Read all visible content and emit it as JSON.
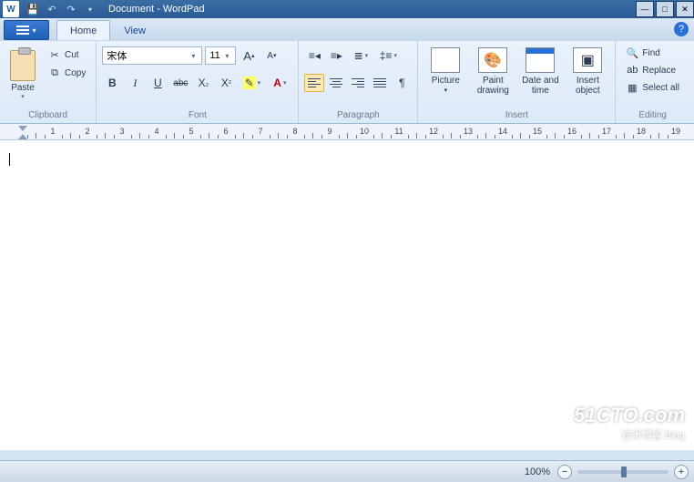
{
  "title": "Document - WordPad",
  "tabs": {
    "home": "Home",
    "view": "View"
  },
  "clipboard": {
    "paste": "Paste",
    "cut": "Cut",
    "copy": "Copy",
    "label": "Clipboard"
  },
  "font": {
    "name": "宋体",
    "size": "11",
    "label": "Font"
  },
  "paragraph": {
    "label": "Paragraph"
  },
  "insert": {
    "picture": "Picture",
    "paint": "Paint drawing",
    "date": "Date and time",
    "object": "Insert object",
    "label": "Insert"
  },
  "editing": {
    "find": "Find",
    "replace": "Replace",
    "selectall": "Select all",
    "label": "Editing"
  },
  "ruler_numbers": [
    "1",
    "2",
    "3",
    "4",
    "5",
    "6",
    "7",
    "8",
    "9",
    "10",
    "11",
    "12",
    "13",
    "14",
    "15",
    "16",
    "17",
    "18",
    "19"
  ],
  "status": {
    "zoom": "100%"
  },
  "watermark": {
    "line1": "51CTO.com",
    "line2": "技术博客   Blog"
  }
}
